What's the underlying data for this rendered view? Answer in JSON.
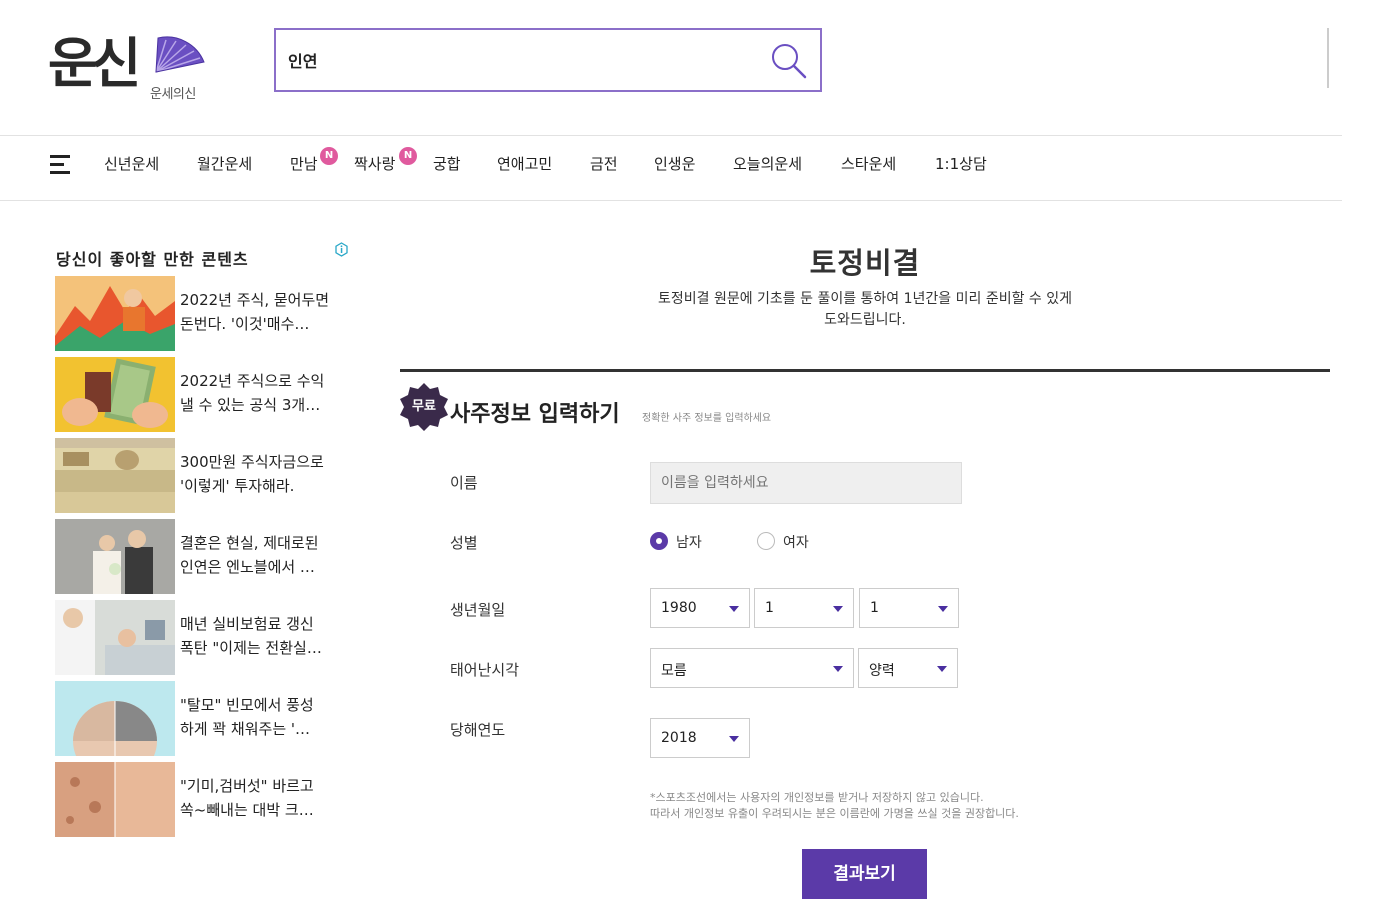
{
  "header": {
    "logo_main": "운신",
    "logo_sub": "운세의신",
    "search_value": "인연"
  },
  "nav": {
    "items": [
      {
        "label": "신년운세"
      },
      {
        "label": "월간운세"
      },
      {
        "label": "만남",
        "badge": "N"
      },
      {
        "label": "짝사랑",
        "badge": "N"
      },
      {
        "label": "궁합"
      },
      {
        "label": "연애고민"
      },
      {
        "label": "금전"
      },
      {
        "label": "인생운"
      },
      {
        "label": "오늘의운세"
      },
      {
        "label": "스타운세"
      },
      {
        "label": "1:1상담"
      }
    ]
  },
  "sidebar": {
    "title": "당신이 좋아할 만한 콘텐츠",
    "items": [
      {
        "line1": "2022년 주식, 묻어두면",
        "line2": "돈번다. '이것'매수…"
      },
      {
        "line1": "2022년 주식으로 수익",
        "line2": "낼 수 있는 공식 3개…"
      },
      {
        "line1": "300만원 주식자금으로",
        "line2": "'이렇게' 투자해라."
      },
      {
        "line1": "결혼은 현실, 제대로된",
        "line2": "인연은 엔노블에서 …"
      },
      {
        "line1": "매년 실비보험료 갱신",
        "line2": "폭탄 \"이제는 전환실…"
      },
      {
        "line1": "\"탈모\" 빈모에서 풍성",
        "line2": "하게 꽉 채워주는 '…"
      },
      {
        "line1": "\"기미,검버섯\" 바르고",
        "line2": "쏙~빼내는 대박 크…"
      }
    ]
  },
  "main": {
    "title": "토정비결",
    "desc_line1": "토정비결 원문에 기초를 둔 풀이를 통하여 1년간을 미리 준비할 수 있게",
    "desc_line2": "도와드립니다.",
    "free_badge": "무료",
    "section_title": "사주정보 입력하기",
    "section_sub": "정확한 사주 정보를 입력하세요"
  },
  "form": {
    "name_label": "이름",
    "name_placeholder": "이름을 입력하세요",
    "gender_label": "성별",
    "gender_male": "남자",
    "gender_female": "여자",
    "birth_label": "생년월일",
    "birth_year": "1980",
    "birth_month": "1",
    "birth_day": "1",
    "time_label": "태어난시각",
    "time_value": "모름",
    "calendar_value": "양력",
    "year_label": "당해연도",
    "year_value": "2018",
    "notice_line1": "*스포츠조선에서는 사용자의 개인정보를 받거나 저장하지 않고 있습니다.",
    "notice_line2": "따라서 개인정보 유출이 우려되시는 분은 이름란에 가명을 쓰실 것을 권장합니다.",
    "submit_label": "결과보기"
  },
  "colors": {
    "accent": "#5b3aa8",
    "search_border": "#8b6fc9",
    "badge": "#e05a9e",
    "dark_badge": "#3a2a4a"
  }
}
